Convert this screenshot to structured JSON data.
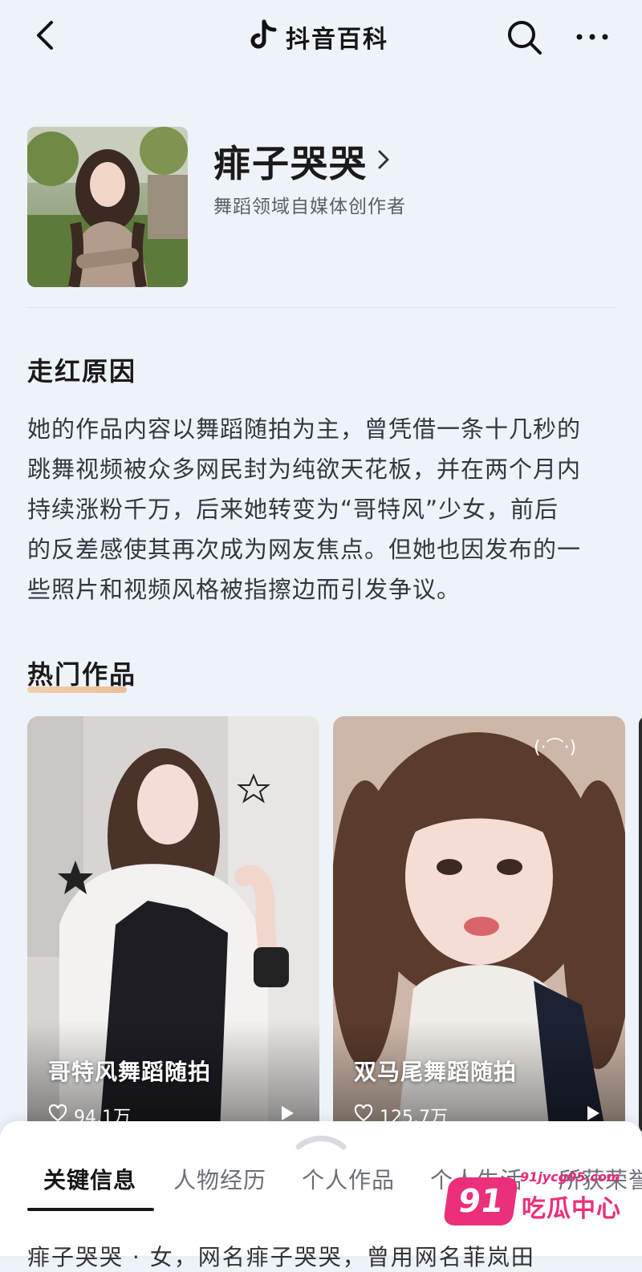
{
  "topbar": {
    "brand": "抖音百科"
  },
  "profile": {
    "name": "痱子哭哭",
    "subtitle": "舞蹈领域自媒体创作者"
  },
  "reason": {
    "title": "走红原因",
    "lines": [
      "她的作品内容以舞蹈随拍为主，曾凭借一条十几秒的",
      "跳舞视频被众多网民封为纯欲天花板，并在两个月内",
      "持续涨粉千万，后来她转变为“哥特风”少女，前后",
      "的反差感使其再次成为网友焦点。但她也因发布的一",
      "些照片和视频风格被指擦边而引发争议。"
    ]
  },
  "works": {
    "title": "热门作品",
    "items": [
      {
        "title": "哥特风舞蹈随拍",
        "likes": "94.1万"
      },
      {
        "title": "双马尾舞蹈随拍",
        "likes": "125.7万"
      }
    ]
  },
  "tabs": [
    {
      "label": "关键信息",
      "active": true
    },
    {
      "label": "人物经历",
      "active": false
    },
    {
      "label": "个人作品",
      "active": false
    },
    {
      "label": "个人生活",
      "active": false
    },
    {
      "label": "所获荣誉",
      "active": false
    }
  ],
  "bottom_peek": "痱子哭哭 · 女，网名痱子哭哭，曾用网名菲岚田",
  "watermark": {
    "url": "91jycg05.com",
    "number": "91",
    "text": "吃瓜中心"
  },
  "colors": {
    "background": "#eef3fa",
    "accent_underline": "#eab484",
    "watermark_pink": "#ec2f7b"
  },
  "icons": [
    "back-arrow-icon",
    "douyin-logo-icon",
    "search-icon",
    "more-icon",
    "chevron-right-icon",
    "heart-icon",
    "play-icon",
    "collapse-handle-icon"
  ]
}
